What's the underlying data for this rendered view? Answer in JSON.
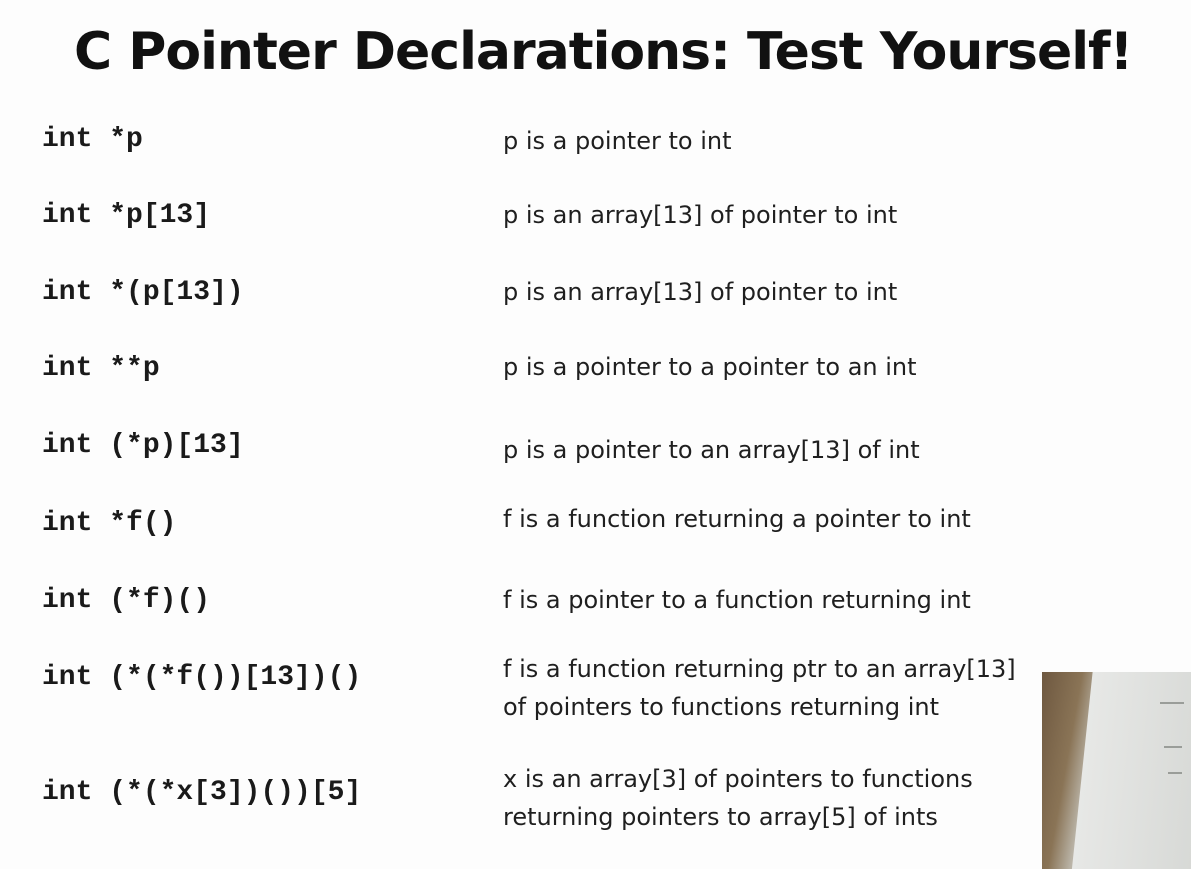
{
  "slide": {
    "title": "C Pointer Declarations: Test Yourself!",
    "rows": [
      {
        "code": "int *p",
        "desc": [
          "p is a pointer to int"
        ]
      },
      {
        "code": "int *p[13]",
        "desc": [
          "p is an array[13] of pointer to int"
        ]
      },
      {
        "code": "int *(p[13])",
        "desc": [
          "p is an array[13] of pointer to int"
        ]
      },
      {
        "code": "int **p",
        "desc": [
          "p is a pointer to a pointer to an int"
        ]
      },
      {
        "code": "int (*p)[13]",
        "desc": [
          "p is a pointer to an array[13] of int"
        ]
      },
      {
        "code": "int *f()",
        "desc": [
          "f is a function returning a pointer to int"
        ]
      },
      {
        "code": "int (*f)()",
        "desc": [
          "f is a pointer to a function returning int"
        ]
      },
      {
        "code": "int (*(*f())[13])()",
        "desc": [
          "f is a function returning ptr to an array[13]",
          "of pointers to functions returning int"
        ]
      },
      {
        "code": "int (*(*x[3])())[5]",
        "desc": [
          "x is an array[3] of pointers  to functions",
          "returning pointers to array[5] of ints"
        ]
      }
    ]
  }
}
